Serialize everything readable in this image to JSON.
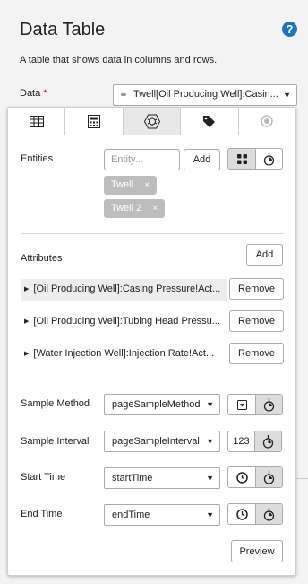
{
  "header": {
    "title": "Data Table",
    "help_icon": "?",
    "description": "A table that shows data in columns and rows.",
    "data_label": "Data",
    "required_mark": "*",
    "data_value": "Twell[Oil Producing Well]:Casin..."
  },
  "tabs": [
    {
      "name": "table-icon"
    },
    {
      "name": "calculator-icon"
    },
    {
      "name": "data-settings-icon",
      "active": true
    },
    {
      "name": "tag-icon"
    },
    {
      "name": "record-icon",
      "disabled": true
    }
  ],
  "entities": {
    "label": "Entities",
    "placeholder": "Entity...",
    "add_label": "Add",
    "chips": [
      "Twell",
      "Twell 2"
    ],
    "remove_glyph": "×"
  },
  "attributes": {
    "label": "Attributes",
    "add_label": "Add",
    "items": [
      "[Oil Producing Well]:Casing Pressure!Act...",
      "[Oil Producing Well]:Tubing Head Pressu...",
      "[Water Injection Well]:Injection Rate!Act..."
    ],
    "remove_label": "Remove"
  },
  "settings": {
    "sample_method_label": "Sample Method",
    "sample_method_value": "pageSampleMethod",
    "sample_interval_label": "Sample Interval",
    "sample_interval_value": "pageSampleInterval",
    "sample_interval_number": "123",
    "start_time_label": "Start Time",
    "start_time_value": "startTime",
    "end_time_label": "End Time",
    "end_time_value": "endTime"
  },
  "preview_label": "Preview",
  "colors": {
    "accent": "#1e73be",
    "required": "#cc0000",
    "chip": "#bdbdbd"
  }
}
